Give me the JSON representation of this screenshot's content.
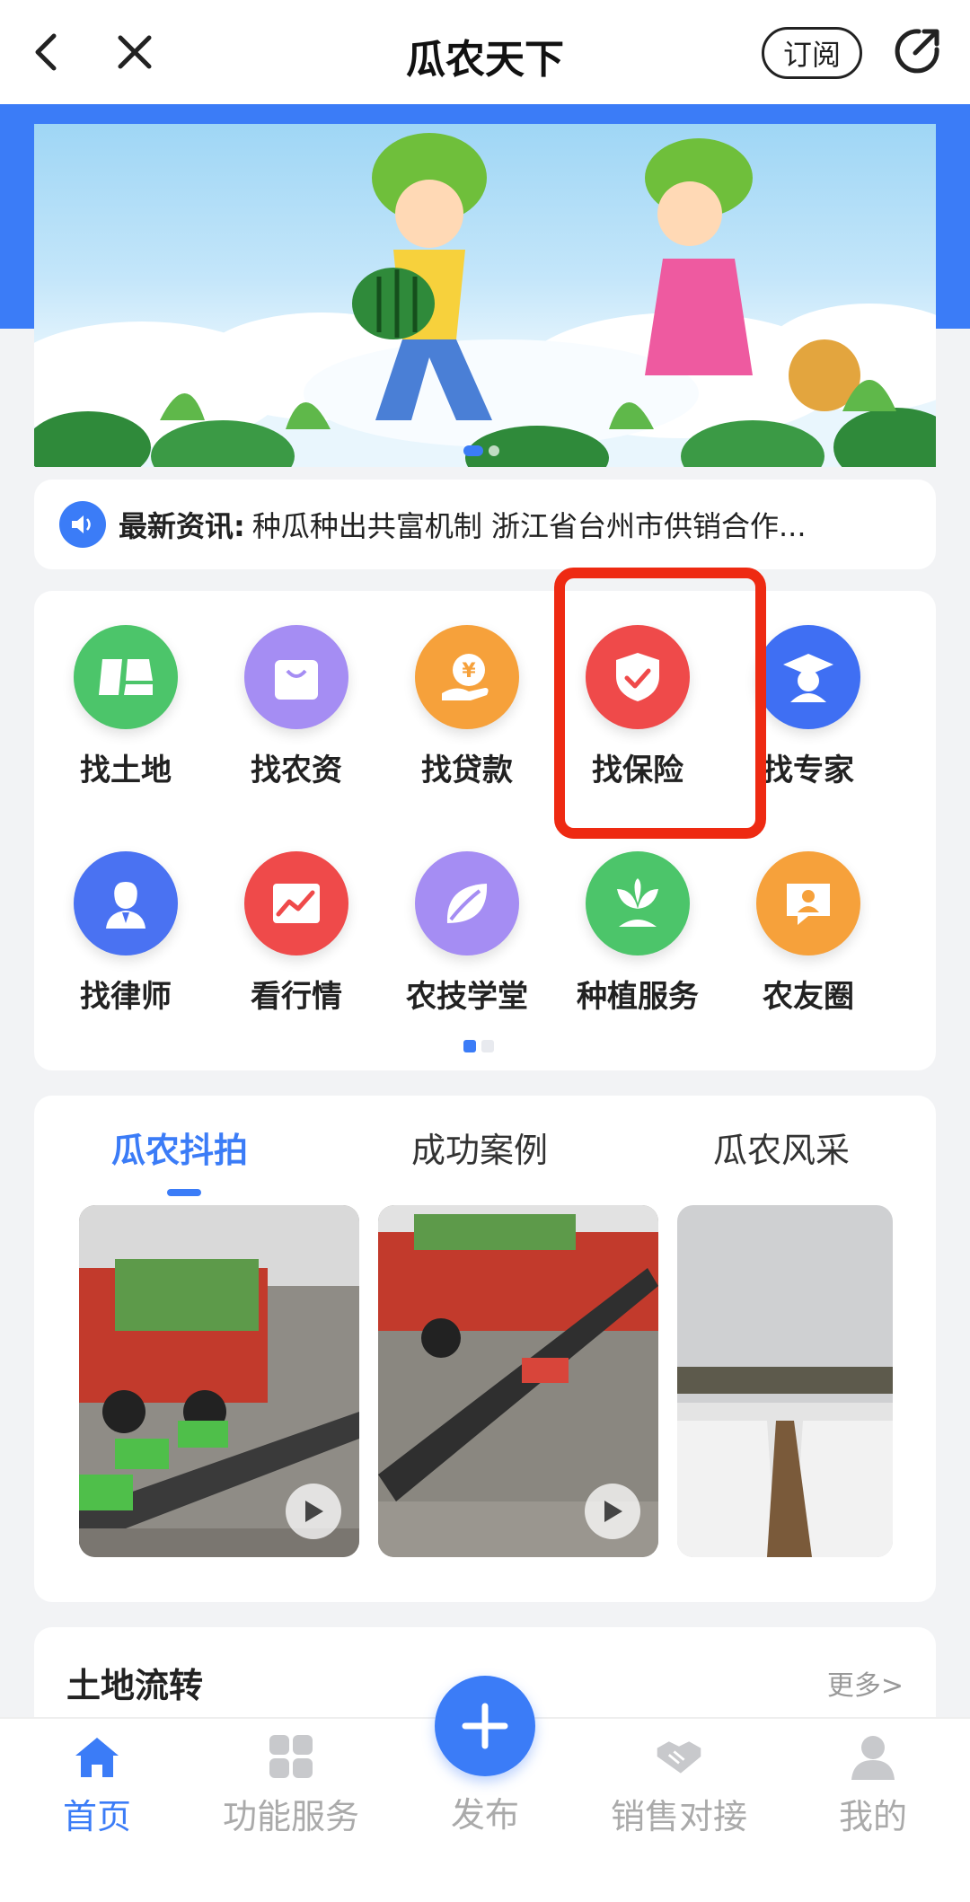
{
  "header": {
    "title": "瓜农天下",
    "subscribe_label": "订阅"
  },
  "ticker": {
    "label": "最新资讯:",
    "text": "种瓜种出共富机制 浙江省台州市供销合作..."
  },
  "services": [
    {
      "label": "找土地",
      "icon": "land-icon",
      "color": "#4cc56a"
    },
    {
      "label": "找农资",
      "icon": "shopping-bag-icon",
      "color": "#a58df3"
    },
    {
      "label": "找贷款",
      "icon": "loan-yuan-icon",
      "color": "#f6a13b"
    },
    {
      "label": "找保险",
      "icon": "insurance-shield-icon",
      "color": "#ef4a4a"
    },
    {
      "label": "找专家",
      "icon": "expert-graduate-icon",
      "color": "#3f6ff3"
    },
    {
      "label": "找律师",
      "icon": "lawyer-icon",
      "color": "#4a72f2"
    },
    {
      "label": "看行情",
      "icon": "market-trend-icon",
      "color": "#ef4a4a"
    },
    {
      "label": "农技学堂",
      "icon": "leaf-icon",
      "color": "#a58df3"
    },
    {
      "label": "种植服务",
      "icon": "sprout-icon",
      "color": "#4cc56a"
    },
    {
      "label": "农友圈",
      "icon": "chat-user-icon",
      "color": "#f6a13b"
    }
  ],
  "video_tabs": [
    {
      "label": "瓜农抖拍",
      "active": true
    },
    {
      "label": "成功案例",
      "active": false
    },
    {
      "label": "瓜农风采",
      "active": false
    }
  ],
  "land": {
    "title": "土地流转",
    "more": "更多>"
  },
  "tabbar": [
    {
      "label": "首页",
      "icon": "home-icon",
      "active": true
    },
    {
      "label": "功能服务",
      "icon": "grid-icon",
      "active": false
    },
    {
      "label": "发布",
      "icon": "plus-icon",
      "active": false
    },
    {
      "label": "销售对接",
      "icon": "handshake-icon",
      "active": false
    },
    {
      "label": "我的",
      "icon": "user-icon",
      "active": false
    }
  ],
  "colors": {
    "accent": "#3b7cf7",
    "highlight": "#ee2a12"
  }
}
